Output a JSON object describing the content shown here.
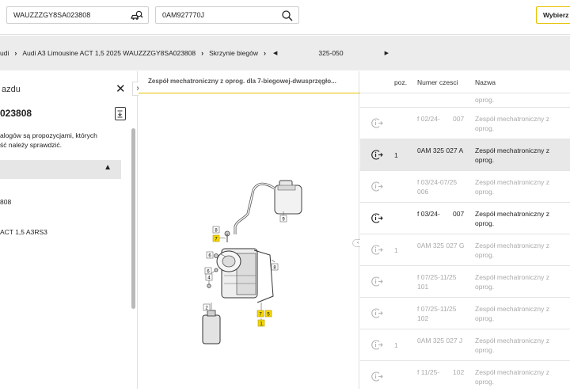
{
  "topbar": {
    "vin_search": "WAUZZZGY8SA023808",
    "part_search": "0AM927770J",
    "choose_button": "Wybierz"
  },
  "breadcrumb": {
    "items": [
      "udi",
      "Audi A3 Limousine ACT 1,5 2025 WAUZZZGY8SA023808",
      "Skrzynie biegów"
    ],
    "page": "325-050"
  },
  "left_panel": {
    "title": "azdu",
    "vin": "023808",
    "note_line1": "alogów są propozycjami, których",
    "note_line2": "ść należy sprawdzić.",
    "value1": "808",
    "value2": "ACT 1,5 A3RS3"
  },
  "diagram": {
    "title": "Zespół mechatroniczny z oprog. dla 7-biegowej-dwusprzęgło...",
    "callouts": [
      "9",
      "8",
      "7",
      "6",
      "6",
      "4",
      "8",
      "7",
      "5",
      "1",
      "2"
    ]
  },
  "table": {
    "headers": {
      "pos": "poz.",
      "part_number": "Numer czesci",
      "name": "Nazwa"
    },
    "rows": [
      {
        "pos": "",
        "part": "",
        "part2": "",
        "name1": "",
        "name2": "oprog.",
        "state": "dim"
      },
      {
        "pos": "",
        "part": "f 02/24-",
        "part_right": "007",
        "part2": "",
        "name1": "Zespół mechatroniczny z",
        "name2": "oprog.",
        "state": "dim"
      },
      {
        "pos": "1",
        "part": "0AM 325 027 A",
        "part_right": "",
        "part2": "",
        "name1": "Zespół mechatroniczny z",
        "name2": "oprog.",
        "state": "sel"
      },
      {
        "pos": "",
        "part": "f 03/24-07/25",
        "part_right": "",
        "part2": "006",
        "name1": "Zespół mechatroniczny z",
        "name2": "oprog.",
        "state": "dim"
      },
      {
        "pos": "",
        "part": "f 03/24-",
        "part_right": "007",
        "part2": "",
        "name1": "Zespół mechatroniczny z",
        "name2": "oprog.",
        "state": "active"
      },
      {
        "pos": "1",
        "part": "0AM 325 027 G",
        "part_right": "",
        "part2": "",
        "name1": "Zespół mechatroniczny z",
        "name2": "oprog.",
        "state": "dim"
      },
      {
        "pos": "",
        "part": "f 07/25-11/25",
        "part_right": "",
        "part2": "101",
        "name1": "Zespół mechatroniczny z",
        "name2": "oprog.",
        "state": "dim"
      },
      {
        "pos": "",
        "part": "f 07/25-11/25",
        "part_right": "",
        "part2": "102",
        "name1": "Zespół mechatroniczny z",
        "name2": "oprog.",
        "state": "dim"
      },
      {
        "pos": "1",
        "part": "0AM 325 027 J",
        "part_right": "",
        "part2": "",
        "name1": "Zespół mechatroniczny z",
        "name2": "oprog.",
        "state": "dim"
      },
      {
        "pos": "",
        "part": "f 11/25-",
        "part_right": "102",
        "part2": "",
        "name1": "Zespół mechatroniczny z",
        "name2": "oprog.",
        "state": "dim"
      }
    ]
  },
  "colors": {
    "accent": "#e6c300",
    "dim_text": "#a9a9a9",
    "selected_row": "#e8e8e8"
  }
}
